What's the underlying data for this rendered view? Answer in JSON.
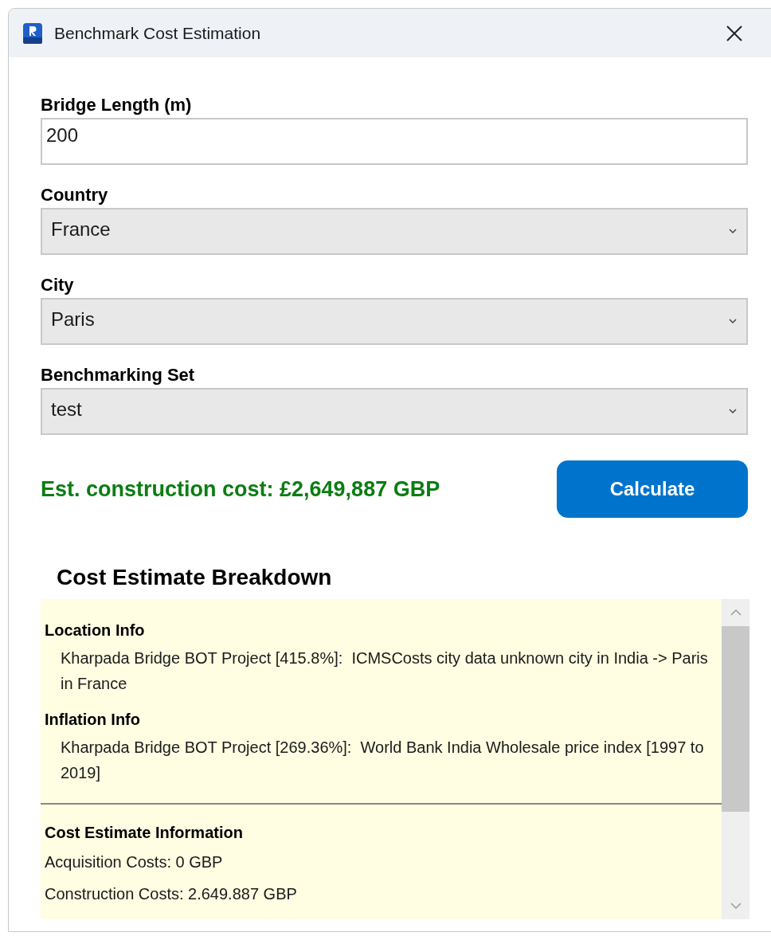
{
  "window": {
    "title": "Benchmark Cost Estimation"
  },
  "fields": [
    {
      "kind": "text",
      "label": "Bridge Length (m)",
      "value": "200"
    },
    {
      "kind": "select",
      "label": "Country",
      "value": "France"
    },
    {
      "kind": "select",
      "label": "City",
      "value": "Paris"
    },
    {
      "kind": "select",
      "label": "Benchmarking Set",
      "value": "test"
    }
  ],
  "result": "Est. construction cost: £2,649,887 GBP",
  "calculate_button": "Calculate",
  "breakdown": {
    "title": "Cost Estimate Breakdown",
    "sections": [
      {
        "kind": "info",
        "heading": "Location Info",
        "lines": [
          "Kharpada Bridge BOT Project [415.8%]:  ICMSCosts city data unknown city in India -> Paris in France"
        ]
      },
      {
        "kind": "info",
        "heading": "Inflation Info",
        "lines": [
          "Kharpada Bridge BOT Project [269.36%]:  World Bank India Wholesale price index [1997 to 2019]"
        ]
      },
      {
        "kind": "costs",
        "heading": "Cost Estimate Information",
        "lines": [
          "Acquisition Costs: 0 GBP",
          "Construction Costs: 2.649.887 GBP"
        ]
      }
    ]
  }
}
